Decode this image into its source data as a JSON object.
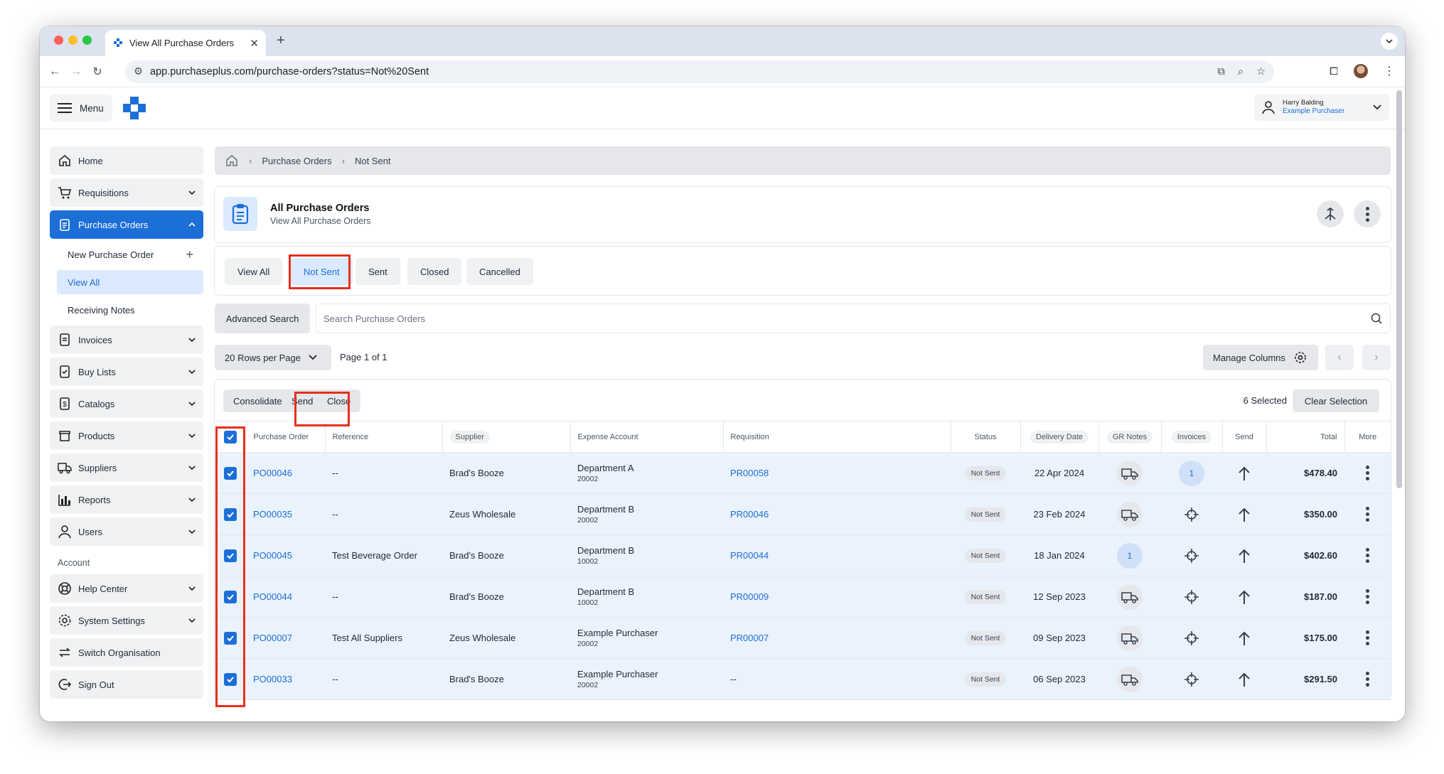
{
  "browser": {
    "tab_title": "View All Purchase Orders",
    "url": "app.purchaseplus.com/purchase-orders?status=Not%20Sent"
  },
  "header": {
    "menu_label": "Menu",
    "user_name": "Harry Balding",
    "user_org": "Example Purchaser"
  },
  "sidebar": {
    "items": [
      {
        "label": "Home",
        "icon": "home-icon"
      },
      {
        "label": "Requisitions",
        "icon": "cart-icon"
      },
      {
        "label": "Purchase Orders",
        "icon": "clipboard-icon"
      },
      {
        "label": "Invoices",
        "icon": "invoice-icon"
      },
      {
        "label": "Buy Lists",
        "icon": "buylist-icon"
      },
      {
        "label": "Catalogs",
        "icon": "catalog-icon"
      },
      {
        "label": "Products",
        "icon": "products-icon"
      },
      {
        "label": "Suppliers",
        "icon": "truck-icon"
      },
      {
        "label": "Reports",
        "icon": "reports-icon"
      },
      {
        "label": "Users",
        "icon": "user-icon"
      }
    ],
    "sub_items": [
      "New Purchase Order",
      "View All",
      "Receiving Notes"
    ],
    "account_section": "Account",
    "account_items": [
      {
        "label": "Help Center",
        "icon": "lifebuoy-icon"
      },
      {
        "label": "System Settings",
        "icon": "gear-icon"
      },
      {
        "label": "Switch Organisation",
        "icon": "switch-icon"
      },
      {
        "label": "Sign Out",
        "icon": "signout-icon"
      }
    ]
  },
  "breadcrumb": [
    "Purchase Orders",
    "Not Sent"
  ],
  "page": {
    "title": "All Purchase Orders",
    "subtitle": "View All Purchase Orders"
  },
  "filters": [
    "View All",
    "Not Sent",
    "Sent",
    "Closed",
    "Cancelled"
  ],
  "active_filter": "Not Sent",
  "search": {
    "advanced_label": "Advanced Search",
    "placeholder": "Search Purchase Orders"
  },
  "pager": {
    "rows_per_page": "20 Rows per Page",
    "page_info": "Page 1 of 1",
    "manage_columns": "Manage Columns"
  },
  "actions": {
    "consolidate": "Consolidate",
    "send": "Send",
    "close": "Close",
    "selected_count": "6 Selected",
    "clear_selection": "Clear Selection"
  },
  "table": {
    "headers": [
      "Purchase Order",
      "Reference",
      "Supplier",
      "Expense Account",
      "Requisition",
      "Status",
      "Delivery Date",
      "GR Notes",
      "Invoices",
      "Send",
      "Total",
      "More"
    ],
    "rows": [
      {
        "po": "PO00046",
        "reference": "--",
        "supplier": "Brad's Booze",
        "account": "Department A",
        "account_code": "20002",
        "requisition": "PR00058",
        "status": "Not Sent",
        "delivery": "22 Apr 2024",
        "gr": "truck",
        "invoices": "1",
        "total": "$478.40"
      },
      {
        "po": "PO00035",
        "reference": "--",
        "supplier": "Zeus Wholesale",
        "account": "Department B",
        "account_code": "20002",
        "requisition": "PR00046",
        "status": "Not Sent",
        "delivery": "23 Feb 2024",
        "gr": "truck",
        "invoices": "",
        "total": "$350.00"
      },
      {
        "po": "PO00045",
        "reference": "Test Beverage Order",
        "supplier": "Brad's Booze",
        "account": "Department B",
        "account_code": "10002",
        "requisition": "PR00044",
        "status": "Not Sent",
        "delivery": "18 Jan 2024",
        "gr": "1",
        "invoices": "",
        "total": "$402.60"
      },
      {
        "po": "PO00044",
        "reference": "--",
        "supplier": "Brad's Booze",
        "account": "Department B",
        "account_code": "10002",
        "requisition": "PR00009",
        "status": "Not Sent",
        "delivery": "12 Sep 2023",
        "gr": "truck",
        "invoices": "",
        "total": "$187.00"
      },
      {
        "po": "PO00007",
        "reference": "Test All Suppliers",
        "supplier": "Zeus Wholesale",
        "account": "Example Purchaser",
        "account_code": "20002",
        "requisition": "PR00007",
        "status": "Not Sent",
        "delivery": "09 Sep 2023",
        "gr": "truck",
        "invoices": "",
        "total": "$175.00"
      },
      {
        "po": "PO00033",
        "reference": "--",
        "supplier": "Brad's Booze",
        "account": "Example Purchaser",
        "account_code": "20002",
        "requisition": "--",
        "status": "Not Sent",
        "delivery": "06 Sep 2023",
        "gr": "truck",
        "invoices": "",
        "total": "$291.50"
      }
    ]
  },
  "colors": {
    "accent": "#1d6fd8",
    "highlight": "#e5301e",
    "row_selected": "#eaf2fc"
  }
}
